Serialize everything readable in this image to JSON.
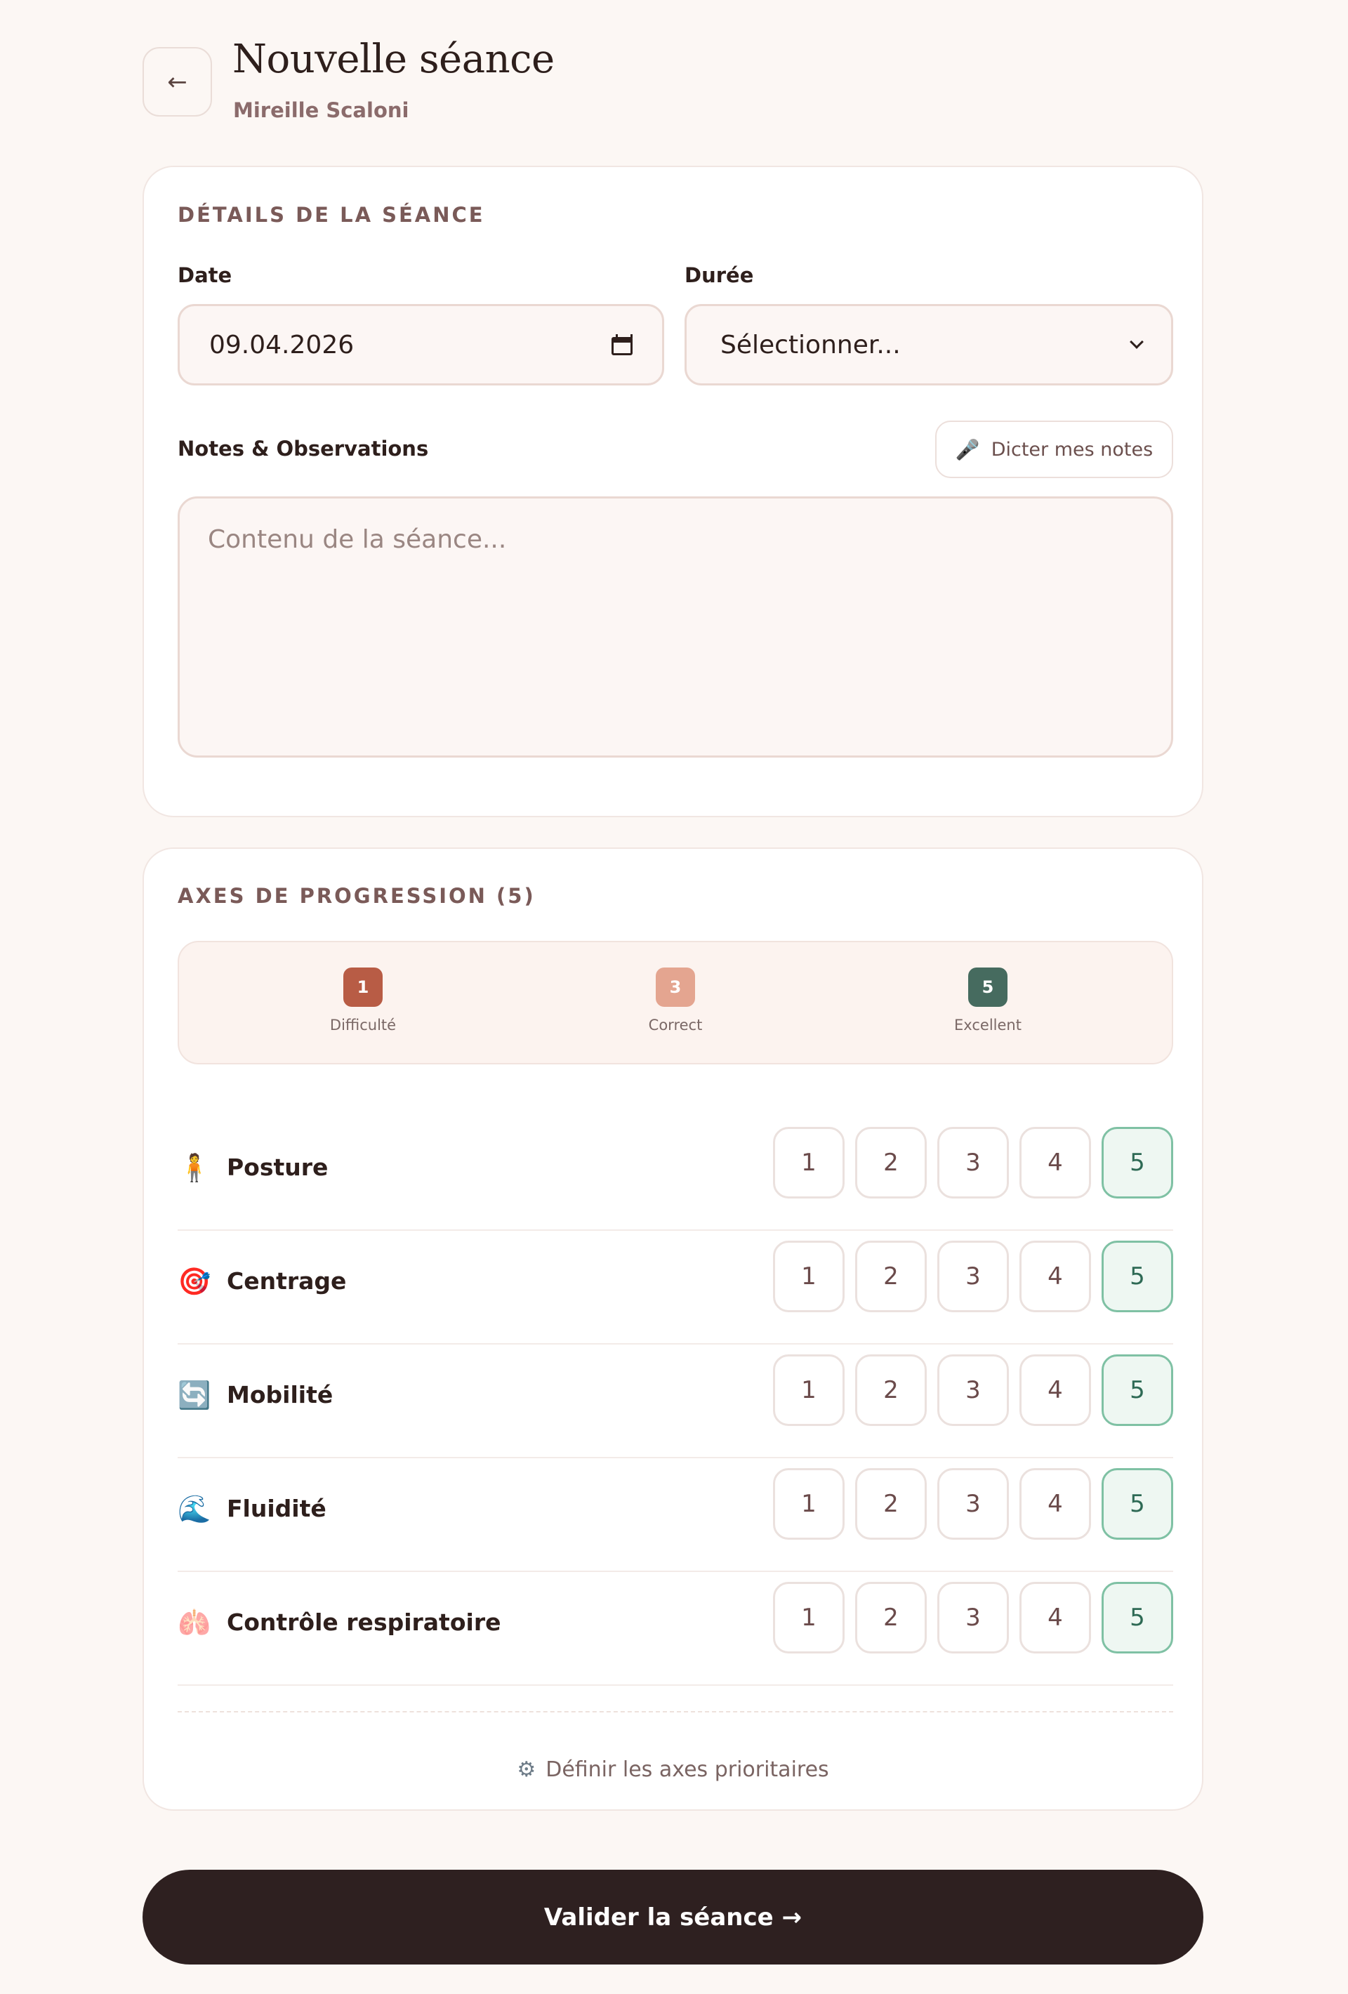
{
  "header": {
    "back_icon": "←",
    "title": "Nouvelle séance",
    "subtitle": "Mireille Scaloni"
  },
  "details": {
    "section_title": "DÉTAILS DE LA SÉANCE",
    "date_label": "Date",
    "date_value": "09.04.2026",
    "duration_label": "Durée",
    "duration_value": "Sélectionner...",
    "notes_label": "Notes & Observations",
    "dictate_icon": "🎤",
    "dictate_label": "Dicter mes notes",
    "notes_placeholder": "Contenu de la séance..."
  },
  "progression": {
    "section_title": "AXES DE PROGRESSION (5)",
    "legend": [
      {
        "value": "1",
        "label": "Difficulté",
        "color": "#b85c45"
      },
      {
        "value": "3",
        "label": "Correct",
        "color": "#e4a590"
      },
      {
        "value": "5",
        "label": "Excellent",
        "color": "#466b5f"
      }
    ],
    "rating_options": [
      "1",
      "2",
      "3",
      "4",
      "5"
    ],
    "axes": [
      {
        "icon": "🧍",
        "label": "Posture",
        "selected": 5
      },
      {
        "icon": "🎯",
        "label": "Centrage",
        "selected": 5
      },
      {
        "icon": "🔄",
        "label": "Mobilité",
        "selected": 5
      },
      {
        "icon": "🌊",
        "label": "Fluidité",
        "selected": 5
      },
      {
        "icon": "🫁",
        "label": "Contrôle respiratoire",
        "selected": 5
      }
    ],
    "define_icon": "⚙",
    "define_label": "Définir les axes prioritaires"
  },
  "submit_label": "Valider la séance →",
  "colors": {
    "background": "#fcf7f4",
    "selected_border": "#7fc1a4",
    "selected_text": "#2e6a55",
    "primary_button": "#2e2020"
  }
}
